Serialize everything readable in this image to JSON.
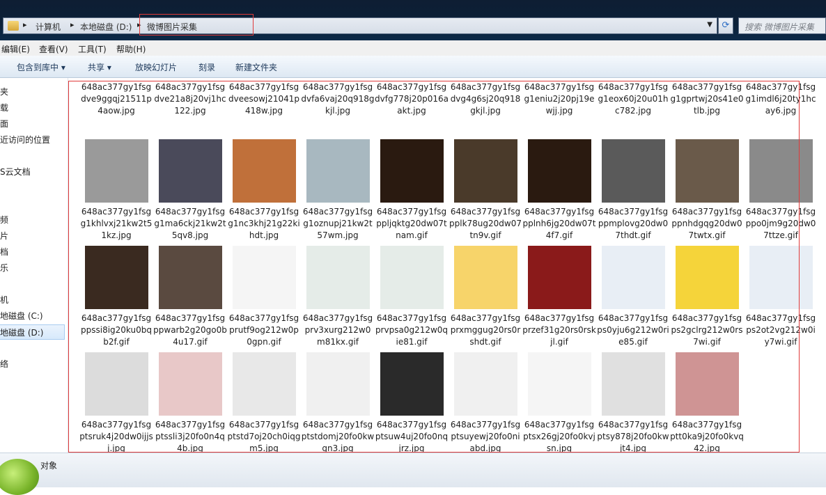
{
  "address_bar": {
    "segments": [
      "计算机",
      "本地磁盘 (D:)",
      "微博图片采集"
    ],
    "search_placeholder": "搜索 微博图片采集"
  },
  "menu": [
    "编辑(E)",
    "查看(V)",
    "工具(T)",
    "帮助(H)"
  ],
  "toolbar": [
    "包含到库中 ▾",
    "共享 ▾",
    "放映幻灯片",
    "刻录",
    "新建文件夹"
  ],
  "nav_pane": [
    "夹",
    "载",
    "面",
    "近访问的位置",
    "S云文档",
    "频",
    "片",
    "档",
    "乐",
    "机",
    "地磁盘 (C:)",
    "地磁盘 (D:)",
    "络"
  ],
  "status": {
    "count_text": "对象"
  },
  "rows": [
    [
      "648ac377gy1fsgdve9ggqj21511p4aow.jpg",
      "648ac377gy1fsgdve21a8j20vj1hc122.jpg",
      "648ac377gy1fsgdveesowj21041p418w.jpg",
      "648ac377gy1fsgdvfa6vaj20q918gkjl.jpg",
      "648ac377gy1fsgdvfg778j20p016aakt.jpg",
      "648ac377gy1fsgdvg4g6sj20q918gkjl.jpg",
      "648ac377gy1fsgg1eniu2j20pj19ewjj.jpg",
      "648ac377gy1fsgg1eox60j20u01hc782.jpg",
      "648ac377gy1fsgg1gprtwj20s41e0tlb.jpg",
      "648ac377gy1fsgg1imdl6j20ty1hcay6.jpg"
    ],
    [
      "648ac377gy1fsgg1khlvxj21kw2t51kz.jpg",
      "648ac377gy1fsgg1ma6ckj21kw2t5qv8.jpg",
      "648ac377gy1fsgg1nc3khj21g22kihdt.jpg",
      "648ac377gy1fsgg1oznupj21kw2t57wm.jpg",
      "648ac377gy1fsgppljqktg20dw07tnam.gif",
      "648ac377gy1fsgpplk78ug20dw07tn9v.gif",
      "648ac377gy1fsgpplnh6jg20dw07t4f7.gif",
      "648ac377gy1fsgppmplovg20dw07thdt.gif",
      "648ac377gy1fsgppnhdgqg20dw07twtx.gif",
      "648ac377gy1fsgppo0jm9g20dw07ttze.gif"
    ],
    [
      "648ac377gy1fsgppssi8ig20ku0bqb2f.gif",
      "648ac377gy1fsgppwarb2g20go0b4u17.gif",
      "648ac377gy1fsgprutf9og212w0p0gpn.gif",
      "648ac377gy1fsgprv3xurg212w0m81kx.gif",
      "648ac377gy1fsgprvpsa0g212w0qie81.gif",
      "648ac377gy1fsgprxmggug20rs0rshdt.gif",
      "648ac377gy1fsgprzef31g20rs0rskjl.gif",
      "648ac377gy1fsgps0yju6g212w0rie85.gif",
      "648ac377gy1fsgps2gclrg212w0rs7wi.gif",
      "648ac377gy1fsgps2ot2vg212w0iy7wi.gif"
    ],
    [
      "648ac377gy1fsgptsruk4j20dw0ijjsj.jpg",
      "648ac377gy1fsgptssli3j20fo0n4q4b.jpg",
      "648ac377gy1fsgptstd7oj20ch0iqgm5.jpg",
      "648ac377gy1fsgptstdomj20fo0kwgn3.jpg",
      "648ac377gy1fsgptsuw4uj20fo0nqjrz.jpg",
      "648ac377gy1fsgptsuyewj20fo0niabd.jpg",
      "648ac377gy1fsgptsx26gj20fo0kvjsn.jpg",
      "648ac377gy1fsgptsy878j20fo0kwjt4.jpg",
      "648ac377gy1fsgptt0ka9j20fo0kvq42.jpg"
    ]
  ],
  "thumb_colors": [
    [
      "#8a3a1a",
      "#2d1a3a",
      "#1c3a3a",
      "#2a1a4a",
      "#3a2a2a",
      "#2a2a3a",
      "#4a5a7a",
      "#2a6aa0",
      "#4a7aa8",
      "#1a7a5a"
    ],
    [
      "#9a9a9a",
      "#4a4a5a",
      "#c0703a",
      "#a8b8c0",
      "#2a1a10",
      "#4a3a2a",
      "#2a1a10",
      "#5a5a5a",
      "#6a5a4a",
      "#8a8a8a"
    ],
    [
      "#3a2a20",
      "#5a4a40",
      "#f5f5f5",
      "#e5ece8",
      "#e5ece8",
      "#f7d46a",
      "#8a1a1a",
      "#e8eef5",
      "#f5d43a",
      "#e8eef5"
    ],
    [
      "#dcdcdc",
      "#e8c8c8",
      "#e8e8e8",
      "#f0f0f0",
      "#2a2a2a",
      "#f0f0f0",
      "#f5f5f5",
      "#e0e0e0",
      "#cf9494"
    ]
  ]
}
